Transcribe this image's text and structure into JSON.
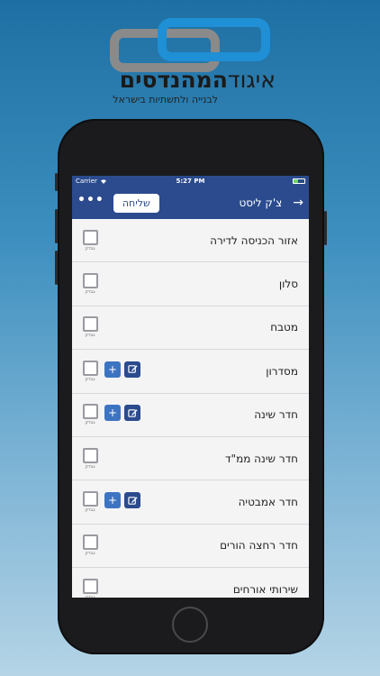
{
  "logo": {
    "title_strong": "המהנדסים",
    "title_thin": "איגוד",
    "subtitle": "לבנייה ולתשתיות בישראל"
  },
  "status": {
    "carrier": "Carrier",
    "time": "5:27 PM",
    "battery_level": 0.45
  },
  "nav": {
    "title": "צ'ק ליסט",
    "send_label": "שליחה",
    "more_label": "•••",
    "back_icon": "arrow-right-icon"
  },
  "checklist": {
    "check_label": "נבדק",
    "items": [
      {
        "label": "אזור הכניסה לדירה",
        "has_actions": false
      },
      {
        "label": "סלון",
        "has_actions": false
      },
      {
        "label": "מטבח",
        "has_actions": false
      },
      {
        "label": "מסדרון",
        "has_actions": true
      },
      {
        "label": "חדר שינה",
        "has_actions": true
      },
      {
        "label": "חדר שינה ממ\"ד",
        "has_actions": false
      },
      {
        "label": "חדר אמבטיה",
        "has_actions": true
      },
      {
        "label": "חדר רחצה הורים",
        "has_actions": false
      },
      {
        "label": "שירותי אורחים",
        "has_actions": false
      }
    ]
  },
  "colors": {
    "nav_bg": "#2b4b8e",
    "plus_btn": "#3d74c2",
    "edit_btn": "#2b4b8e"
  }
}
